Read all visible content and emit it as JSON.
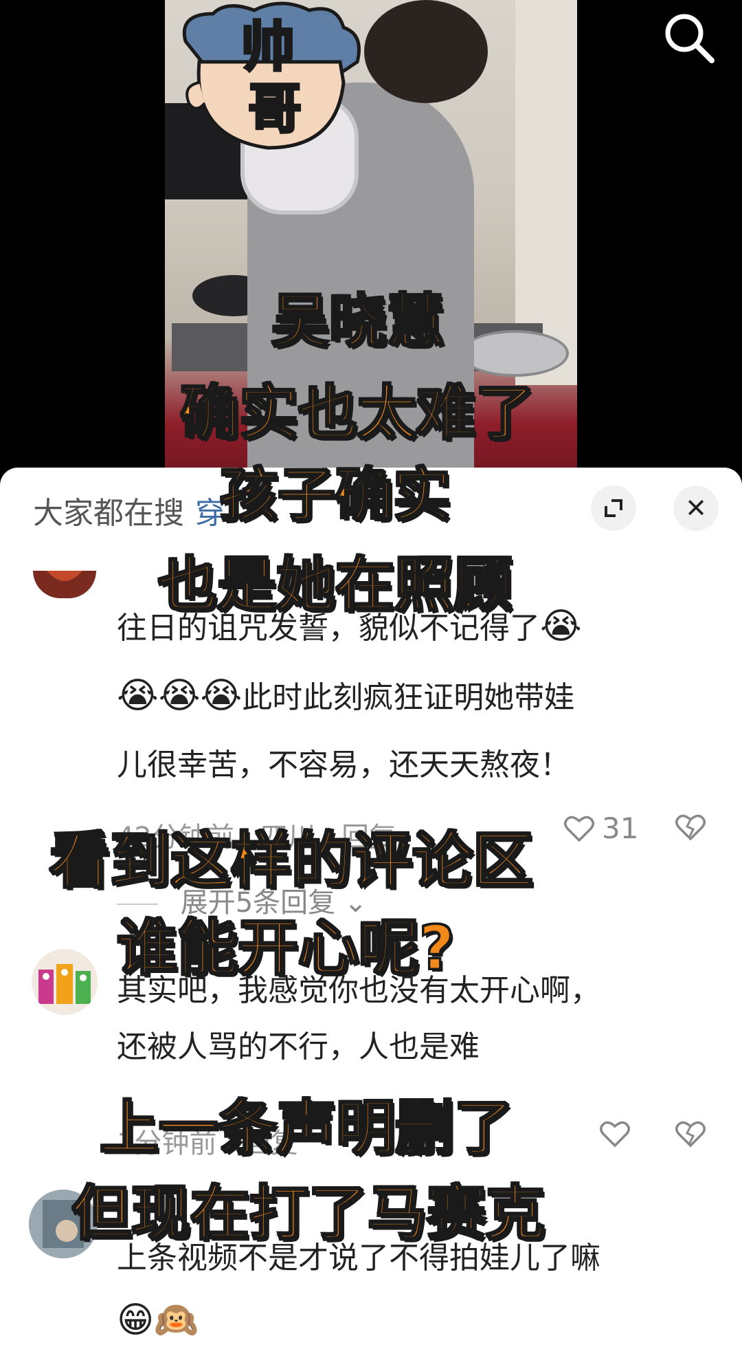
{
  "video": {
    "sticker_text_top": "帅",
    "sticker_text_bottom": "哥",
    "search_icon": "search-icon"
  },
  "panel": {
    "search_hint_prefix": "大家都在搜",
    "search_hint_term": "穿",
    "expand_icon": "expand-icon",
    "close_icon": "close-icon",
    "close_glyph": "✕"
  },
  "comments": [
    {
      "text_line1": "往日的诅咒发誓，貌似不记得了",
      "emoji_1": "😭",
      "emojis_2": "😭😭😭",
      "text_line2": "此时此刻疯狂证明她带娃",
      "text_line3": "儿很幸苦，不容易，还天天熬夜！",
      "meta": "42分钟前 · 四川 · 回复",
      "likes": "31",
      "replies": "展开5条回复"
    },
    {
      "text_line1": "其实吧，我感觉你也没有太开心啊，",
      "text_line2": "还被人骂的不行，人也是难",
      "meta": "1分钟前 · 回复"
    },
    {
      "text_line1": "上条视频不是才说了不得拍娃儿了嘛",
      "emojis": "😁🙉"
    }
  ],
  "captions": [
    "吴晓慧",
    "确实也太难了",
    "孩子确实",
    "也是她在照顾",
    "看到这样的评论区",
    "谁能开心呢?",
    "上一条声明删了",
    "但现在打了马赛克"
  ],
  "colors": {
    "caption": "#f28a1b",
    "caption_outline": "#1a1a1a",
    "link": "#3d6ba6"
  }
}
